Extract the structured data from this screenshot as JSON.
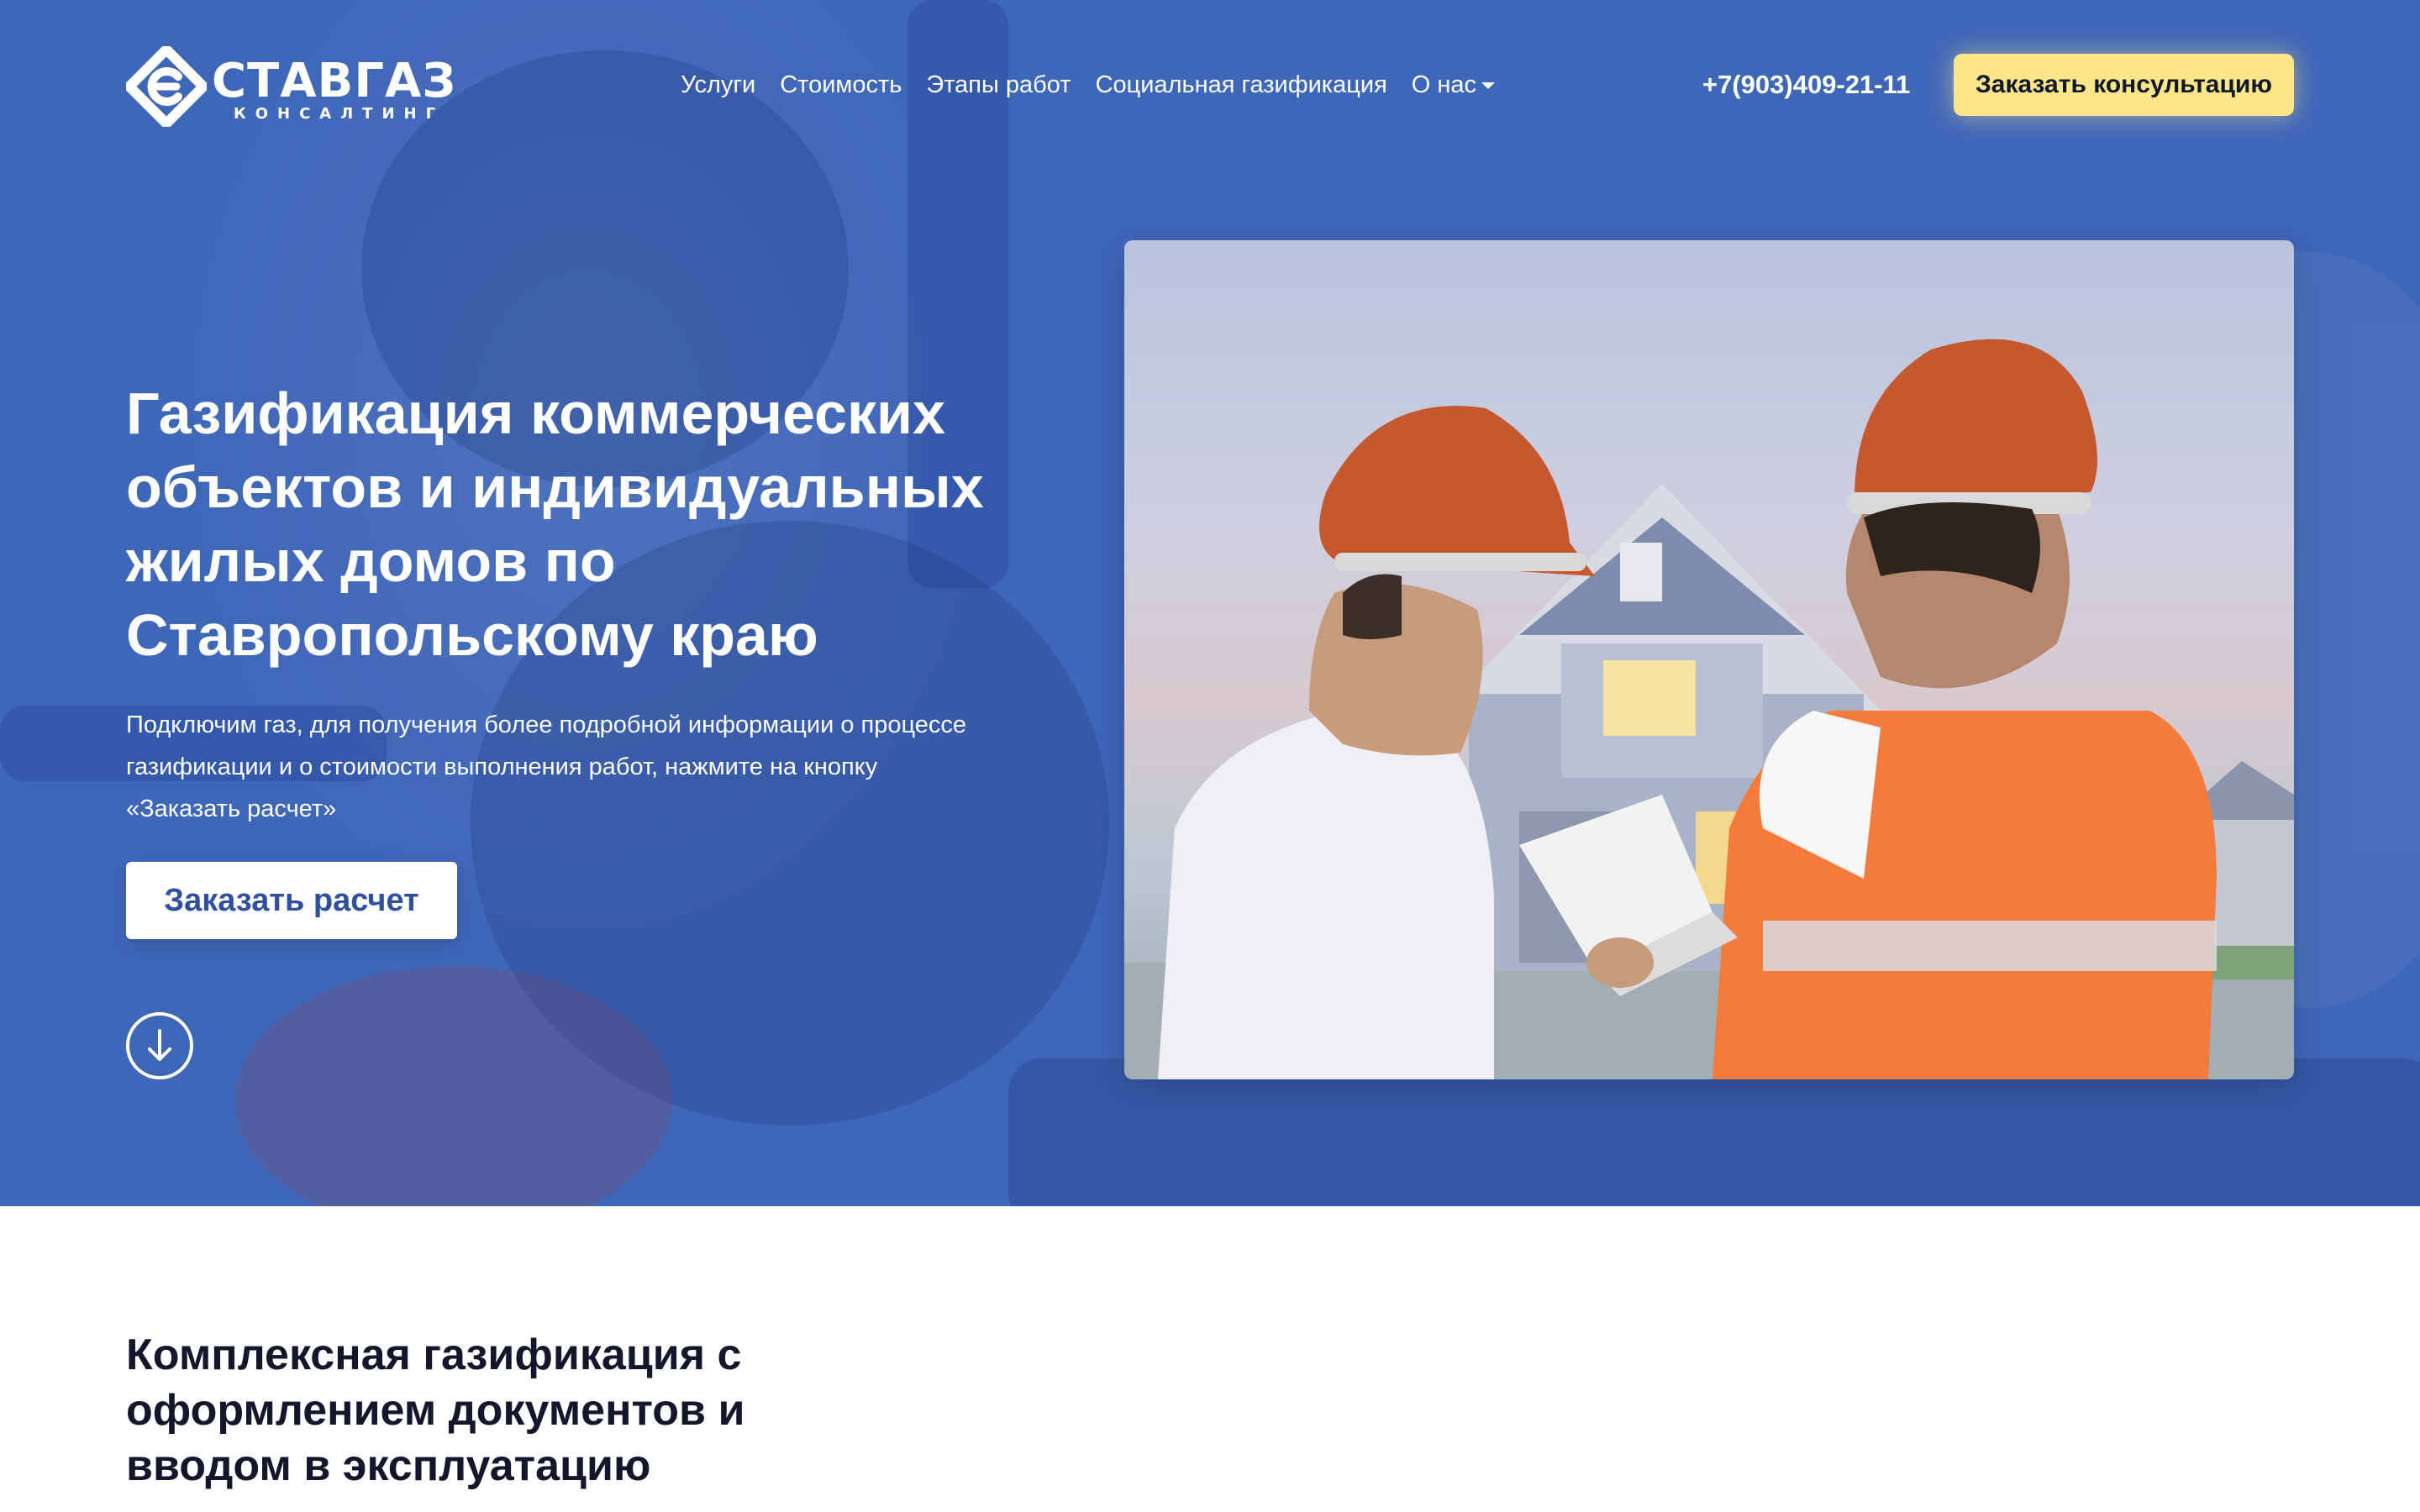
{
  "header": {
    "logo": {
      "name": "СТАВГАЗ",
      "tagline": "КОНСАЛТИНГ"
    },
    "nav": [
      {
        "label": "Услуги"
      },
      {
        "label": "Стоимость"
      },
      {
        "label": "Этапы работ"
      },
      {
        "label": "Социальная газификация"
      },
      {
        "label": "О нас",
        "dropdown": true
      }
    ],
    "phone": "+7(903)409-21-11",
    "cta_label": "Заказать консультацию"
  },
  "hero": {
    "title": "Газификация коммерческих объектов и индивидуальных жилых домов по Ставропольскому краю",
    "description": "Подключим газ, для получения более подробной информации о процессе газификации и о стоимости выполнения работ, нажмите на кнопку «Заказать расчет»",
    "button_label": "Заказать расчет",
    "scroll_icon": "arrow-down-circle-icon"
  },
  "section2": {
    "title": "Комплексная газификация с оформлением документов и вводом в эксплуатацию"
  },
  "colors": {
    "hero_bg": "#3f67b8",
    "cta_yellow": "#fde68a",
    "button_text_blue": "#2f4f9f",
    "heading_dark": "#14172b"
  }
}
